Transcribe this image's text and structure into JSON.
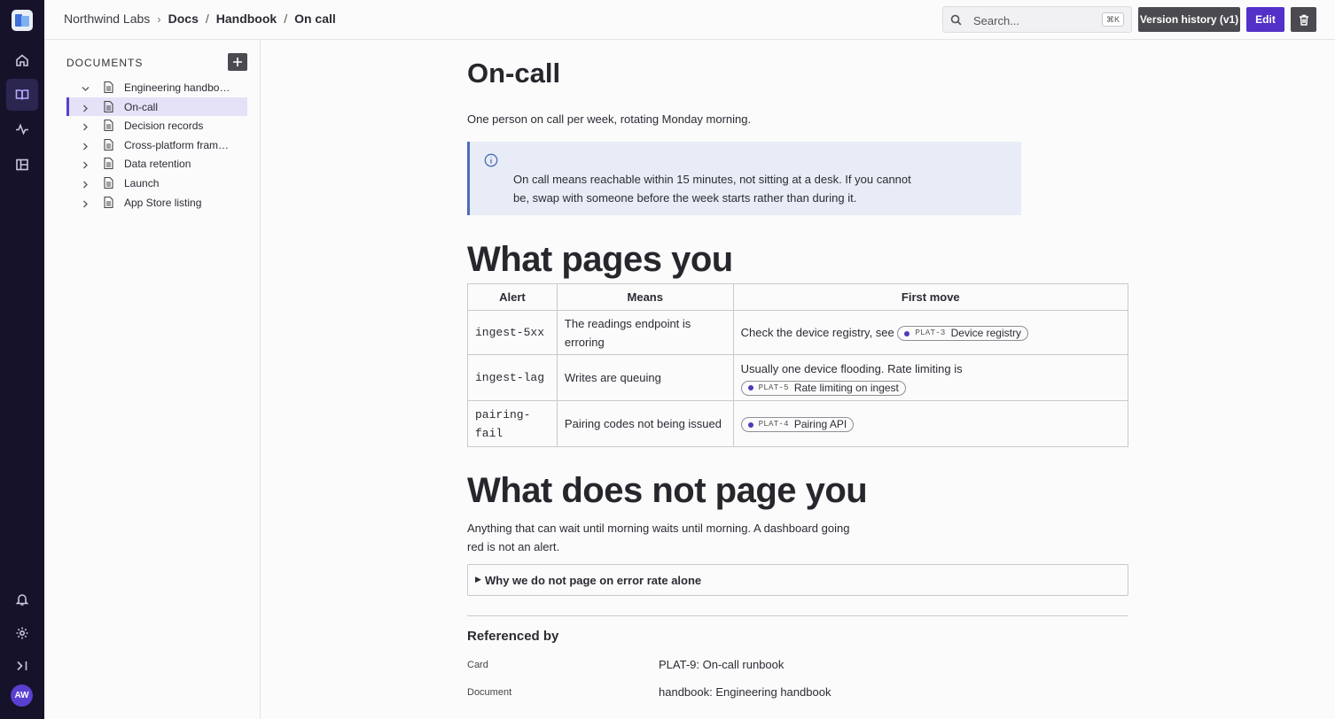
{
  "topbar": {
    "org": "Northwind Labs",
    "crumbs": [
      "Docs",
      "Handbook",
      "On call"
    ],
    "search_placeholder": "Search...",
    "search_shortcut": "⌘K",
    "version_label": "Version history (v1)",
    "edit_label": "Edit"
  },
  "rail": {
    "avatar_initials": "AW"
  },
  "sidebar": {
    "title": "DOCUMENTS",
    "items": [
      {
        "label": "Engineering handbook",
        "expanded": true
      },
      {
        "label": "On-call",
        "active": true
      },
      {
        "label": "Decision records"
      },
      {
        "label": "Cross-platform frame..."
      },
      {
        "label": "Data retention"
      },
      {
        "label": "Launch"
      },
      {
        "label": "App Store listing"
      }
    ]
  },
  "doc": {
    "title": "On-call",
    "intro": "One person on call per week, rotating Monday morning.",
    "callout": "On call means reachable within 15 minutes, not sitting at a desk. If you cannot be, swap with someone before the week starts rather than during it.",
    "h2_pages": "What pages you",
    "table": {
      "headers": [
        "Alert",
        "Means",
        "First move"
      ],
      "rows": [
        {
          "alert": "ingest-5xx",
          "means": "The readings endpoint is erroring",
          "first_text": "Check the device registry, see",
          "chip_key": "PLAT-3",
          "chip_label": "Device registry"
        },
        {
          "alert": "ingest-lag",
          "means": "Writes are queuing",
          "first_text": "Usually one device flooding. Rate limiting is",
          "chip_key": "PLAT-5",
          "chip_label": "Rate limiting on ingest"
        },
        {
          "alert": "pairing-fail",
          "means": "Pairing codes not being issued",
          "first_text": "",
          "chip_key": "PLAT-4",
          "chip_label": "Pairing API"
        }
      ]
    },
    "h2_not": "What does not page you",
    "not_para": "Anything that can wait until morning waits until morning. A dashboard going red is not an alert.",
    "details_label": "Why we do not page on error rate alone",
    "refs_title": "Referenced by",
    "refs": [
      {
        "kind": "Card",
        "value": "PLAT-9: On-call runbook"
      },
      {
        "kind": "Document",
        "value": "handbook: Engineering handbook"
      }
    ]
  },
  "colors": {
    "rail": "#15122a",
    "accent": "#5330c7",
    "callout_bg": "#e8ecf6",
    "callout_border": "#4d6bb9"
  }
}
